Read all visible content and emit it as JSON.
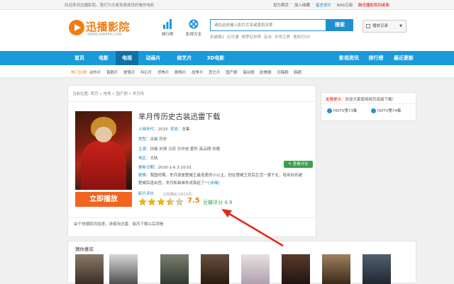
{
  "topbar": {
    "welcome": "欢迎来到迅播影院，我们为大家免费提供好看的电影",
    "links": [
      "设为首页",
      "加入收藏",
      "留言求片",
      "RSS订阅"
    ],
    "highlight_link": "跨迅播影院到桌面"
  },
  "logo": {
    "text": "迅播影院",
    "sub": "WWW.XIAMP4.COM"
  },
  "header_icons": [
    {
      "label": "排行榜",
      "icon": "bar-chart-icon"
    },
    {
      "label": "影视大全",
      "icon": "film-reel-icon"
    }
  ],
  "search": {
    "placeholder": "请在此处输入影片片名或演员名称",
    "button": "搜索",
    "hotwords": [
      "杀破狼2",
      "幻可通",
      "侏罗纪世界",
      "反击",
      "半世之界",
      "鬼吹灯OT"
    ]
  },
  "history_button": "播放记录",
  "nav": {
    "items": [
      "首页",
      "电影",
      "电视",
      "动画片",
      "综艺片",
      "3D电影",
      "影视资讯",
      "排行榜",
      "最近更新"
    ],
    "active": "电视"
  },
  "hotcat": {
    "label": "热门分类：",
    "items": [
      "动作片",
      "喜剧片",
      "爱情片",
      "科幻片",
      "恐怖片",
      "剧情片",
      "战争片",
      "其它片",
      "国产剧",
      "港台剧",
      "欧美剧",
      "日韩剧",
      "韩剧"
    ]
  },
  "breadcrumb": [
    "当前位置:",
    "首页",
    "电视",
    "国产剧",
    "芈月传"
  ],
  "movie": {
    "title": "芈月传历史古装迅雷下载",
    "year_label": "上映年代：",
    "year": "2015",
    "status_label": "状态：",
    "status": "全集",
    "genre_label": "类型：",
    "genre": "古装 历史",
    "cast_label": "主演：",
    "cast": "孙俪 刘涛 马苏 方中信 黄轩 高云翔 刘德",
    "region_label": "地区：",
    "region": "大陆",
    "update_label": "更新日期：",
    "update": "2016-1-6 2:10:01",
    "plot_label": "剧情：",
    "plot_line1": "我国时期，芈月原是楚威王最宠爱的小公主，但在楚威王死后生活一落千丈，母亲向氏被",
    "plot_line2": "楚威后逐出宫，芈月和弟弟芈戎靠赶了一",
    "plot_more": "[详细]",
    "comment_button": "查看评论",
    "play_button": "立即播放",
    "rating_label": "影片评价",
    "rating_sub": "比较精彩(2812评)",
    "stars": 3.5,
    "score": "7.5",
    "douban_label": "豆瓣评分",
    "douban_score": "4.9",
    "tip": "由于快播取消加速，请使用迅雷、旋风下载以后观看"
  },
  "sidebar": {
    "hint_label": "友情提示：",
    "hint_text": "欢迎大家使用网页连接下载！",
    "episodes": [
      "HDTV第73集",
      "HDTV第74集"
    ]
  },
  "recommend": {
    "title": "猜你喜欢"
  },
  "colors": {
    "nav_blue": "#1b9ad8",
    "accent_orange": "#f2641e",
    "green": "#3aa04a",
    "arrow_red": "#e02a1e"
  }
}
